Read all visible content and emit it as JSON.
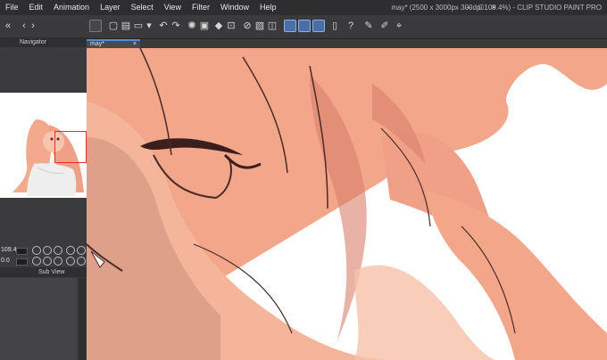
{
  "app": {
    "menus": [
      "File",
      "Edit",
      "Animation",
      "Layer",
      "Select",
      "View",
      "Filter",
      "Window",
      "Help"
    ],
    "window_title": "may* (2500 x 3000px 300dpi 109.4%) - CLIP STUDIO PAINT PRO",
    "window_buttons": [
      "–",
      "□",
      "×"
    ]
  },
  "navigator": {
    "title": "Navigator",
    "zoom_value": "109.4",
    "angle_value": "0.0"
  },
  "subview": {
    "title": "Sub View"
  },
  "document": {
    "tab_label": "may*",
    "tab_close": "×"
  },
  "colors": {
    "skin": "#f4b59a",
    "hair": "#f0a086",
    "hair_shadow": "#d9806a",
    "shadow": "#c98874",
    "line": "#4a2a28",
    "accent": "#4a6fa5"
  }
}
